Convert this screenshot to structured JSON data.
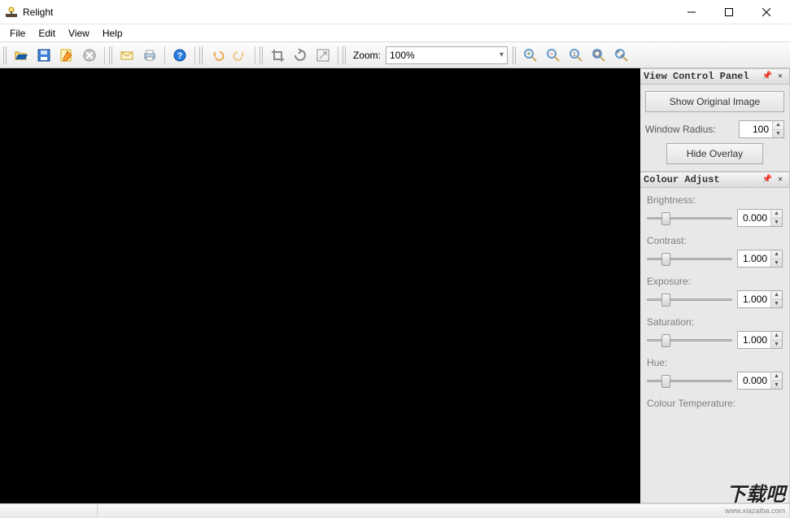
{
  "window": {
    "title": "Relight"
  },
  "menu": {
    "file": "File",
    "edit": "Edit",
    "view": "View",
    "help": "Help"
  },
  "toolbar": {
    "zoom_label": "Zoom:",
    "zoom_value": "100%"
  },
  "view_panel": {
    "title": "View Control Panel",
    "show_original": "Show Original Image",
    "window_radius_label": "Window Radius:",
    "window_radius_value": "100",
    "hide_overlay": "Hide Overlay"
  },
  "colour_panel": {
    "title": "Colour Adjust",
    "brightness": {
      "label": "Brightness:",
      "value": "0.000",
      "pos": 18
    },
    "contrast": {
      "label": "Contrast:",
      "value": "1.000",
      "pos": 18
    },
    "exposure": {
      "label": "Exposure:",
      "value": "1.000",
      "pos": 18
    },
    "saturation": {
      "label": "Saturation:",
      "value": "1.000",
      "pos": 18
    },
    "hue": {
      "label": "Hue:",
      "value": "0.000",
      "pos": 18
    },
    "colour_temp": {
      "label": "Colour Temperature:"
    }
  },
  "watermark": {
    "main": "下载吧",
    "sub": "www.xiazaiba.com"
  }
}
